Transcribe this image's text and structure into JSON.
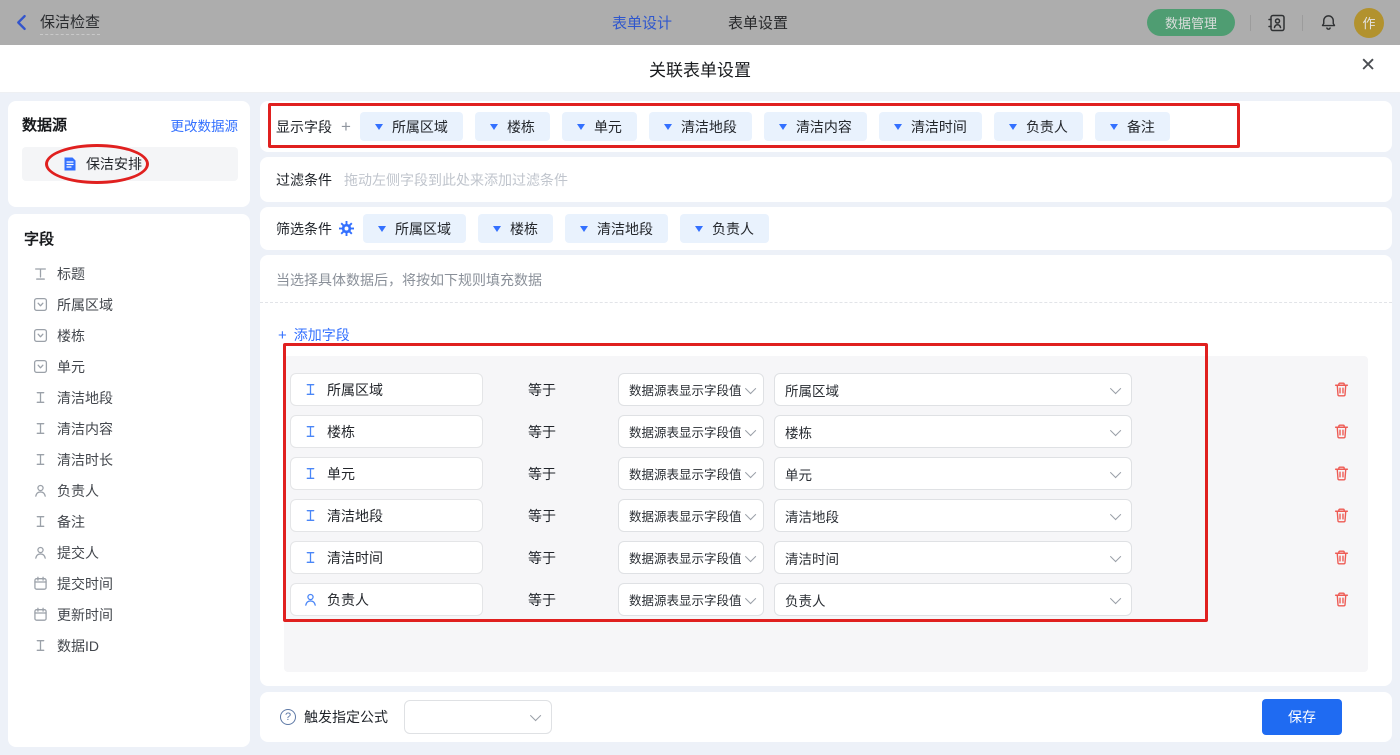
{
  "colors": {
    "accent_blue": "#3370ff",
    "annotation_red": "#e0201f",
    "save_blue": "#1f6bf2",
    "tag_bg": "#e9f2fd",
    "pill_green": "#4f9d72"
  },
  "topbar": {
    "back_label": "保洁检查",
    "tabs": [
      {
        "label": "表单设计",
        "active": true
      },
      {
        "label": "表单设置",
        "active": false
      }
    ],
    "data_manage_button": "数据管理",
    "avatar_text": "作"
  },
  "modal": {
    "title": "关联表单设置",
    "close_icon": "✕"
  },
  "sidebar": {
    "datasource": {
      "heading": "数据源",
      "change_link": "更改数据源",
      "selected": "保洁安排"
    },
    "fields": {
      "heading": "字段",
      "items": [
        {
          "icon": "title",
          "label": "标题"
        },
        {
          "icon": "select",
          "label": "所属区域"
        },
        {
          "icon": "select",
          "label": "楼栋"
        },
        {
          "icon": "select",
          "label": "单元"
        },
        {
          "icon": "text",
          "label": "清洁地段"
        },
        {
          "icon": "text",
          "label": "清洁内容"
        },
        {
          "icon": "text",
          "label": "清洁时长"
        },
        {
          "icon": "user",
          "label": "负责人"
        },
        {
          "icon": "text",
          "label": "备注"
        },
        {
          "icon": "user",
          "label": "提交人"
        },
        {
          "icon": "date",
          "label": "提交时间"
        },
        {
          "icon": "date",
          "label": "更新时间"
        },
        {
          "icon": "text",
          "label": "数据ID"
        }
      ]
    }
  },
  "main": {
    "display_fields": {
      "label": "显示字段",
      "add_icon": "+",
      "tags": [
        "所属区域",
        "楼栋",
        "单元",
        "清洁地段",
        "清洁内容",
        "清洁时间",
        "负责人",
        "备注"
      ]
    },
    "filter": {
      "label": "过滤条件",
      "placeholder": "拖动左侧字段到此处来添加过滤条件"
    },
    "screening": {
      "label": "筛选条件",
      "tags": [
        "所属区域",
        "楼栋",
        "清洁地段",
        "负责人"
      ]
    },
    "rules": {
      "hint": "当选择具体数据后，将按如下规则填充数据",
      "add_plus": "+",
      "add_field_label": "添加字段",
      "rows": [
        {
          "icon": "text",
          "field": "所属区域",
          "operator": "等于",
          "source": "数据源表显示字段值",
          "value": "所属区域"
        },
        {
          "icon": "text",
          "field": "楼栋",
          "operator": "等于",
          "source": "数据源表显示字段值",
          "value": "楼栋"
        },
        {
          "icon": "text",
          "field": "单元",
          "operator": "等于",
          "source": "数据源表显示字段值",
          "value": "单元"
        },
        {
          "icon": "text",
          "field": "清洁地段",
          "operator": "等于",
          "source": "数据源表显示字段值",
          "value": "清洁地段"
        },
        {
          "icon": "text",
          "field": "清洁时间",
          "operator": "等于",
          "source": "数据源表显示字段值",
          "value": "清洁时间"
        },
        {
          "icon": "user",
          "field": "负责人",
          "operator": "等于",
          "source": "数据源表显示字段值",
          "value": "负责人"
        }
      ]
    },
    "footer": {
      "help_icon": "?",
      "formula_label": "触发指定公式",
      "formula_value": "",
      "save_button": "保存"
    }
  }
}
